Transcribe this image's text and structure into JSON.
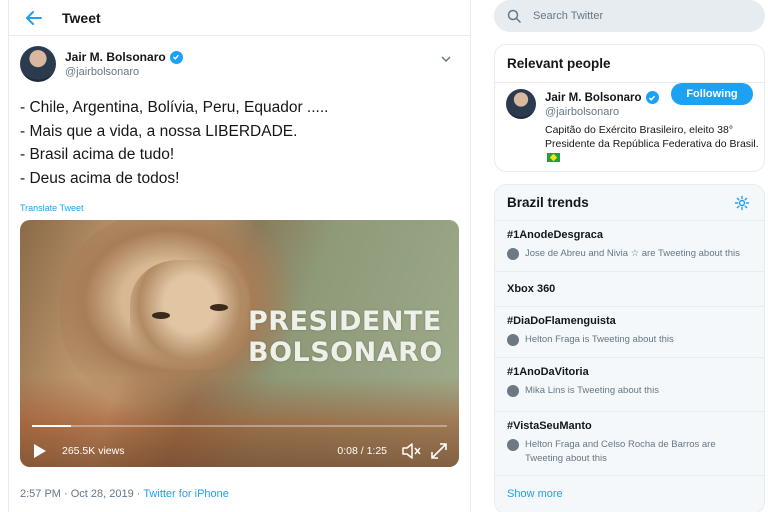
{
  "header": {
    "title": "Tweet",
    "back_icon": "back-arrow-icon"
  },
  "tweet": {
    "author_name": "Jair M. Bolsonaro",
    "author_handle": "@jairbolsonaro",
    "lines": [
      "- Chile, Argentina, Bolívia, Peru, Equador .....",
      "- Mais que a vida, a nossa LIBERDADE.",
      "- Brasil acima de tudo!",
      "- Deus acima de todos!"
    ],
    "translate_label": "Translate Tweet",
    "video": {
      "overlay_line1": "PRESIDENTE",
      "overlay_line2": "BOLSONARO",
      "views": "265.5K views",
      "time": "0:08 / 1:25",
      "progress_fraction": 0.094
    },
    "timestamp": "2:57 PM · Oct 28, 2019 · ",
    "source": "Twitter for iPhone"
  },
  "search": {
    "placeholder": "Search Twitter"
  },
  "relevant_people": {
    "title": "Relevant people",
    "name": "Jair M. Bolsonaro",
    "handle": "@jairbolsonaro",
    "follow_label": "Following",
    "bio": "Capitão do Exército Brasileiro, eleito 38° Presidente da República Federativa do Brasil."
  },
  "trends": {
    "title": "Brazil trends",
    "items": [
      {
        "name": "#1AnodeDesgraca",
        "context": "Jose de Abreu and Nivia ☆ are Tweeting about this"
      },
      {
        "name": "Xbox 360",
        "context": ""
      },
      {
        "name": "#DiaDoFlamenguista",
        "context": "Helton Fraga is Tweeting about this"
      },
      {
        "name": "#1AnoDaVitoria",
        "context": "Mika Lins is Tweeting about this"
      },
      {
        "name": "#VistaSeuManto",
        "context": "Helton Fraga and Celso Rocha de Barros are Tweeting about this"
      }
    ],
    "show_more": "Show more"
  },
  "colors": {
    "accent": "#1da1f2",
    "muted": "#657786",
    "border": "#e6ecf0"
  }
}
